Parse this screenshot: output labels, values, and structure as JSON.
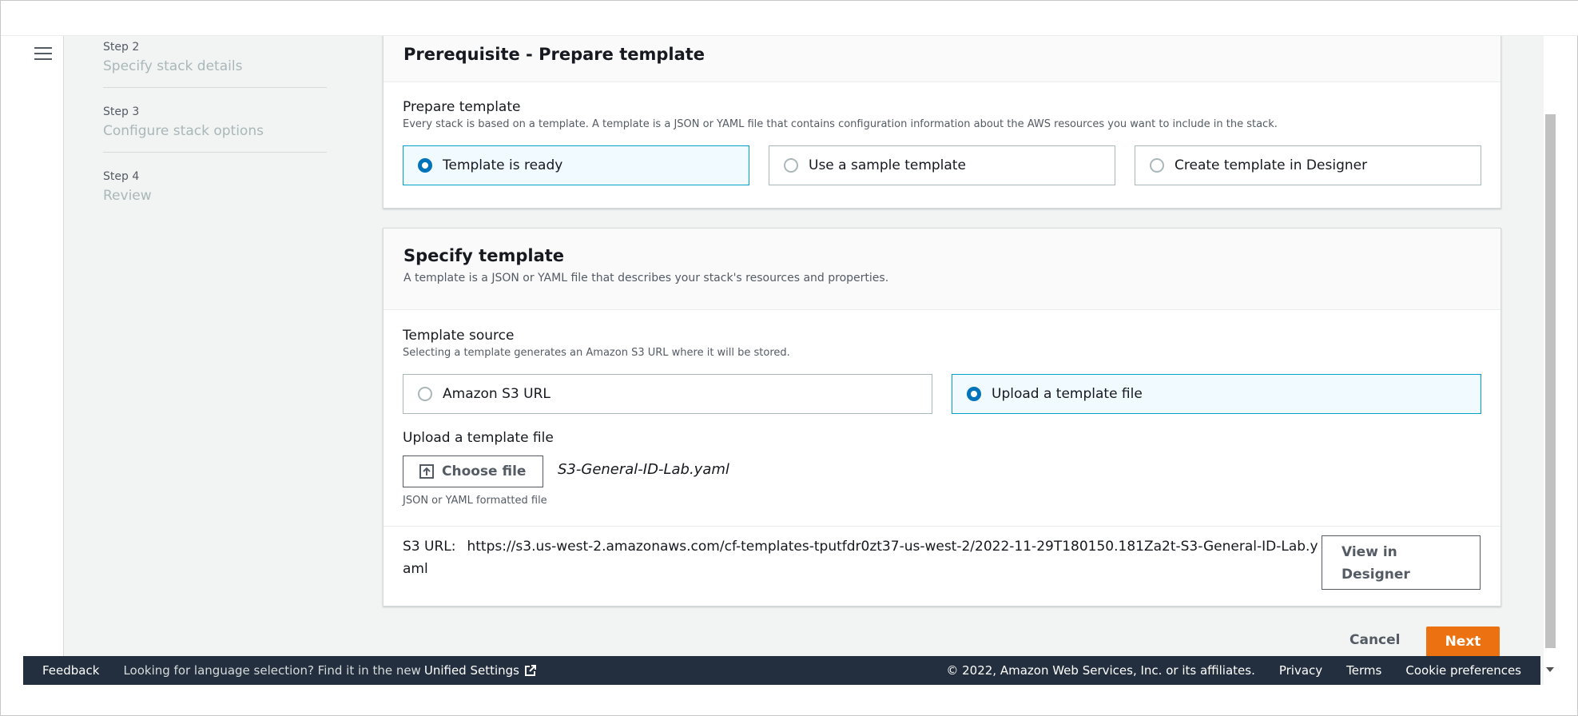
{
  "wizard": {
    "steps": [
      {
        "number": "Step 2",
        "title": "Specify stack details"
      },
      {
        "number": "Step 3",
        "title": "Configure stack options"
      },
      {
        "number": "Step 4",
        "title": "Review"
      }
    ]
  },
  "prerequisite": {
    "title": "Prerequisite - Prepare template",
    "field_label": "Prepare template",
    "field_desc": "Every stack is based on a template. A template is a JSON or YAML file that contains configuration information about the AWS resources you want to include in the stack.",
    "options": [
      "Template is ready",
      "Use a sample template",
      "Create template in Designer"
    ],
    "selected": "Template is ready"
  },
  "specify": {
    "title": "Specify template",
    "desc": "A template is a JSON or YAML file that describes your stack's resources and properties.",
    "source_label": "Template source",
    "source_desc": "Selecting a template generates an Amazon S3 URL where it will be stored.",
    "source_options": [
      "Amazon S3 URL",
      "Upload a template file"
    ],
    "source_selected": "Upload a template file",
    "upload_label": "Upload a template file",
    "choose_file_label": "Choose file",
    "file_name": "S3-General-ID-Lab.yaml",
    "file_hint": "JSON or YAML formatted file",
    "s3_url_label": "S3 URL:",
    "s3_url_value": "https://s3.us-west-2.amazonaws.com/cf-templates-tputfdr0zt37-us-west-2/2022-11-29T180150.181Za2t-S3-General-ID-Lab.yaml",
    "view_in_designer_label": "View in Designer"
  },
  "actions": {
    "cancel_label": "Cancel",
    "next_label": "Next"
  },
  "footer": {
    "feedback": "Feedback",
    "language_text": "Looking for language selection? Find it in the new",
    "unified_settings": "Unified Settings",
    "copyright": "© 2022, Amazon Web Services, Inc. or its affiliates.",
    "privacy": "Privacy",
    "terms": "Terms",
    "cookie_preferences": "Cookie preferences"
  },
  "colors": {
    "accent": "#0073bb",
    "selected_border": "#00a1c9",
    "primary_button": "#ec7211",
    "footer_bg": "#232f3e"
  },
  "icons": [
    "menu-icon",
    "upload-icon",
    "external-link-icon",
    "scroll-down-arrow-icon"
  ]
}
